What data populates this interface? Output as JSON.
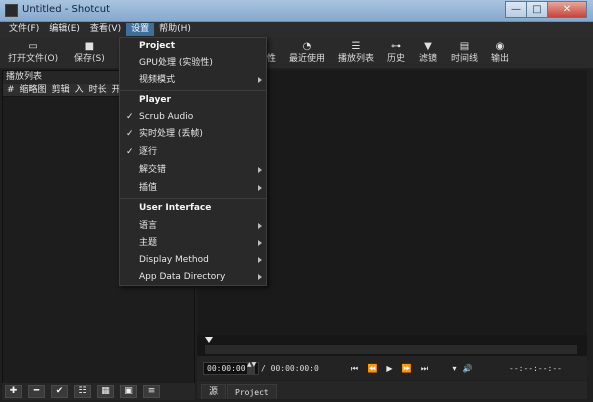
{
  "window": {
    "title": "Untitled - Shotcut",
    "minimize": "—",
    "maximize": "□",
    "close": "✕"
  },
  "menubar": [
    "文件(F)",
    "编辑(E)",
    "查看(V)",
    "设置",
    "帮助(H)"
  ],
  "toolbar": {
    "open_file": "打开文件(O)",
    "save": "保存(S)",
    "properties_partial": "性",
    "recent": "最近使用",
    "playlist": "播放列表",
    "history": "历史",
    "filters": "滤镜",
    "timeline": "时间线",
    "output": "输出"
  },
  "playlist": {
    "title": "播放列表",
    "columns": [
      "#",
      "缩略图",
      "剪辑",
      "入",
      "时长",
      "开始"
    ]
  },
  "settings_menu": {
    "project_header": "Project",
    "gpu": "GPU处理 (实验性)",
    "video_mode": "视频模式",
    "player_header": "Player",
    "scrub_audio": "Scrub Audio",
    "realtime": "实时处理 (丢帧)",
    "progressive": "逐行",
    "deinterlacer": "解交错",
    "interpolation": "插值",
    "ui_header": "User Interface",
    "language": "语言",
    "theme": "主题",
    "display_method": "Display Method",
    "app_data": "App Data Directory"
  },
  "transport": {
    "current": "00:00:00:0",
    "total": "/ 00:00:00:0",
    "in_out": "--:--:--:--"
  },
  "tabs": {
    "source": "源",
    "project": "Project"
  },
  "colors": {
    "menu_active": "#3f6f9d",
    "dark_bg": "#1f1f1f"
  }
}
